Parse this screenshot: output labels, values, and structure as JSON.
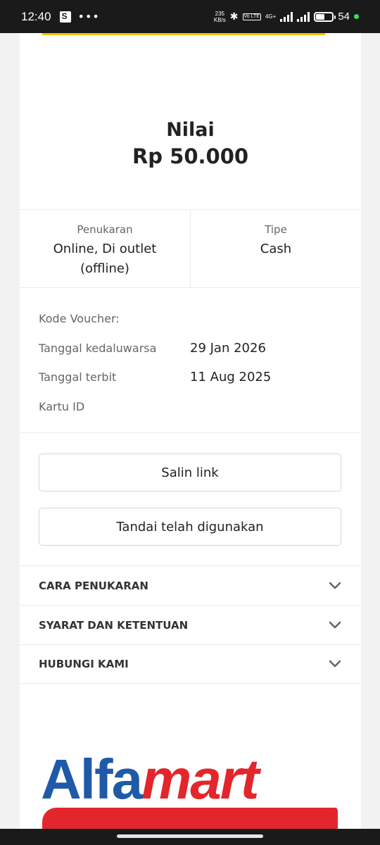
{
  "status_bar": {
    "time": "12:40",
    "dots": "•••",
    "speed_value": "235",
    "speed_unit": "KB/s",
    "volte": "Vo LTE",
    "network": "4G+",
    "battery_text": "54",
    "battery_level": 0.54,
    "bluetooth_icon": "bluetooth-icon"
  },
  "voucher": {
    "value_label": "Nilai",
    "value_amount": "Rp 50.000"
  },
  "info": {
    "redemption_label": "Penukaran",
    "redemption_value": "Online, Di outlet (offline)",
    "type_label": "Tipe",
    "type_value": "Cash"
  },
  "details": {
    "code_label": "Kode Voucher:",
    "code_value": "",
    "expiry_label": "Tanggal kedaluwarsa",
    "expiry_value": "29 Jan 2026",
    "issued_label": "Tanggal terbit",
    "issued_value": "11 Aug 2025",
    "card_label": "Kartu ID",
    "card_value": ""
  },
  "buttons": {
    "copy_link": "Salin link",
    "mark_used": "Tandai telah digunakan"
  },
  "accordion": [
    {
      "title": "CARA PENUKARAN"
    },
    {
      "title": "SYARAT DAN KETENTUAN"
    },
    {
      "title": "HUBUNGI KAMI"
    }
  ],
  "brand": {
    "logo_part1": "Alfa",
    "logo_part2": "mart",
    "blue": "#1f5aa8",
    "red": "#e3262b"
  },
  "colors": {
    "accent_yellow": "#f5c400"
  }
}
